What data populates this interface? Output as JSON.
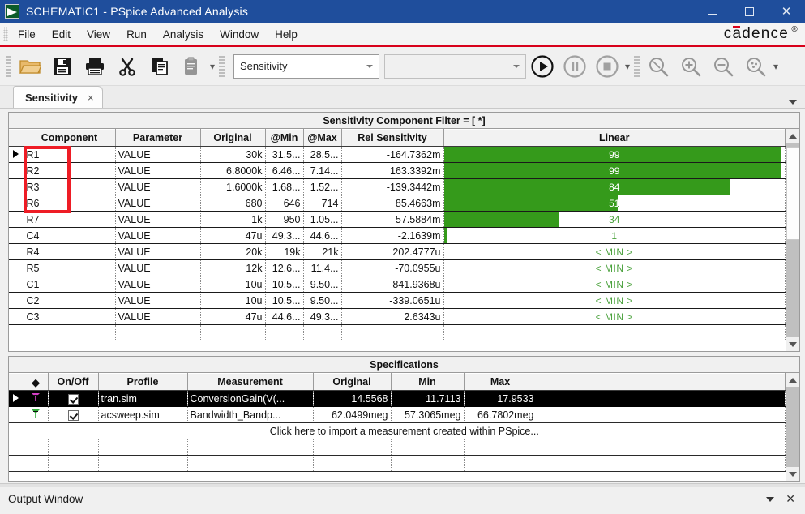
{
  "window": {
    "title": "SCHEMATIC1 - PSpice Advanced Analysis",
    "app_icon": "pspice-icon",
    "minimize": "–",
    "maximize": "□",
    "close": "✕"
  },
  "menubar": {
    "items": [
      "File",
      "Edit",
      "View",
      "Run",
      "Analysis",
      "Window",
      "Help"
    ],
    "brand": "cadence",
    "brand_reg": "®"
  },
  "toolbar": {
    "buttons": [
      {
        "name": "open-icon",
        "title": "Open"
      },
      {
        "name": "save-icon",
        "title": "Save"
      },
      {
        "name": "print-icon",
        "title": "Print"
      },
      {
        "name": "cut-icon",
        "title": "Cut"
      },
      {
        "name": "copy-icon",
        "title": "Copy"
      },
      {
        "name": "paste-icon",
        "title": "Paste"
      }
    ],
    "analysis_combo": {
      "value": "Sensitivity",
      "placeholder": "Sensitivity"
    },
    "profile_combo": {
      "value": "",
      "placeholder": ""
    },
    "run_buttons": [
      {
        "name": "run-icon",
        "title": "Run"
      },
      {
        "name": "pause-icon",
        "title": "Pause"
      },
      {
        "name": "stop-icon",
        "title": "Stop"
      }
    ],
    "zoom_buttons": [
      {
        "name": "zoom-area-icon",
        "title": "Zoom Area"
      },
      {
        "name": "zoom-in-icon",
        "title": "Zoom In"
      },
      {
        "name": "zoom-out-icon",
        "title": "Zoom Out"
      },
      {
        "name": "zoom-fit-icon",
        "title": "Zoom Fit"
      }
    ]
  },
  "tabs": {
    "items": [
      {
        "label": "Sensitivity",
        "close": "×",
        "active": true
      }
    ],
    "overflow_arrow": "chevron-down-icon"
  },
  "sensitivity": {
    "title": "Sensitivity Component Filter = [ *]",
    "columns": [
      "Component",
      "Parameter",
      "Original",
      "@Min",
      "@Max",
      "Rel Sensitivity",
      "Linear"
    ],
    "rows": [
      {
        "component": "R1",
        "parameter": "VALUE",
        "original": "30k",
        "at_min": "31.5...",
        "at_max": "28.5...",
        "rel_sensitivity": "-164.7362m",
        "linear_label": "99",
        "linear_pct": 99,
        "linear_kind": "bar",
        "selected": true
      },
      {
        "component": "R2",
        "parameter": "VALUE",
        "original": "6.8000k",
        "at_min": "6.46...",
        "at_max": "7.14...",
        "rel_sensitivity": "163.3392m",
        "linear_label": "99",
        "linear_pct": 99,
        "linear_kind": "bar",
        "selected": false
      },
      {
        "component": "R3",
        "parameter": "VALUE",
        "original": "1.6000k",
        "at_min": "1.68...",
        "at_max": "1.52...",
        "rel_sensitivity": "-139.3442m",
        "linear_label": "84",
        "linear_pct": 84,
        "linear_kind": "bar",
        "selected": false
      },
      {
        "component": "R6",
        "parameter": "VALUE",
        "original": "680",
        "at_min": "646",
        "at_max": "714",
        "rel_sensitivity": "85.4663m",
        "linear_label": "51",
        "linear_pct": 51,
        "linear_kind": "bar",
        "selected": false
      },
      {
        "component": "R7",
        "parameter": "VALUE",
        "original": "1k",
        "at_min": "950",
        "at_max": "1.05...",
        "rel_sensitivity": "57.5884m",
        "linear_label": "34",
        "linear_pct": 34,
        "linear_kind": "bar",
        "selected": false
      },
      {
        "component": "C4",
        "parameter": "VALUE",
        "original": "47u",
        "at_min": "49.3...",
        "at_max": "44.6...",
        "rel_sensitivity": "-2.1639m",
        "linear_label": "1",
        "linear_pct": 1,
        "linear_kind": "bar",
        "selected": false
      },
      {
        "component": "R4",
        "parameter": "VALUE",
        "original": "20k",
        "at_min": "19k",
        "at_max": "21k",
        "rel_sensitivity": "202.4777u",
        "linear_label": "< MIN >",
        "linear_pct": 0,
        "linear_kind": "min",
        "selected": false
      },
      {
        "component": "R5",
        "parameter": "VALUE",
        "original": "12k",
        "at_min": "12.6...",
        "at_max": "11.4...",
        "rel_sensitivity": "-70.0955u",
        "linear_label": "< MIN >",
        "linear_pct": 0,
        "linear_kind": "min",
        "selected": false
      },
      {
        "component": "C1",
        "parameter": "VALUE",
        "original": "10u",
        "at_min": "10.5...",
        "at_max": "9.50...",
        "rel_sensitivity": "-841.9368u",
        "linear_label": "< MIN >",
        "linear_pct": 0,
        "linear_kind": "min",
        "selected": false
      },
      {
        "component": "C2",
        "parameter": "VALUE",
        "original": "10u",
        "at_min": "10.5...",
        "at_max": "9.50...",
        "rel_sensitivity": "-339.0651u",
        "linear_label": "< MIN >",
        "linear_pct": 0,
        "linear_kind": "min",
        "selected": false
      },
      {
        "component": "C3",
        "parameter": "VALUE",
        "original": "47u",
        "at_min": "44.6...",
        "at_max": "49.3...",
        "rel_sensitivity": "2.6343u",
        "linear_label": "< MIN >",
        "linear_pct": 0,
        "linear_kind": "min",
        "selected": false
      }
    ],
    "highlight_box": {
      "name": "component-column-highlight",
      "color": "#ee1c25"
    },
    "bar_color": "#359a1b",
    "min_text_color": "#4aa13c",
    "scroll": {
      "up": "▲",
      "down": "▼",
      "thumb_top_pct": 2,
      "thumb_height_pct": 48
    }
  },
  "specifications": {
    "title": "Specifications",
    "columns": [
      "",
      "◆",
      "On/Off",
      "Profile",
      "Measurement",
      "Original",
      "Min",
      "Max",
      ""
    ],
    "rows": [
      {
        "marker": "marker-magenta",
        "on_off": true,
        "profile": "tran.sim",
        "measurement": "ConversionGain(V(...",
        "original": "14.5568",
        "min": "11.7113",
        "max": "17.9533",
        "selected": true
      },
      {
        "marker": "marker-green",
        "on_off": true,
        "profile": "acsweep.sim",
        "measurement": "Bandwidth_Bandp...",
        "original": "62.0499meg",
        "min": "57.3065meg",
        "max": "66.7802meg",
        "selected": false
      }
    ],
    "import_hint": "Click here to import a measurement created within PSpice...",
    "scroll": {
      "up": "▲",
      "down": "▼"
    }
  },
  "output_window": {
    "label": "Output Window",
    "collapse_icon": "chevron-down-icon",
    "close_icon": "close-icon",
    "close_glyph": "✕"
  },
  "colors": {
    "titlebar": "#1f4e9c",
    "accent_red": "#d8001a",
    "bar_green": "#359a1b",
    "marker_magenta": "#d63fc7",
    "marker_green": "#2fae3a"
  }
}
